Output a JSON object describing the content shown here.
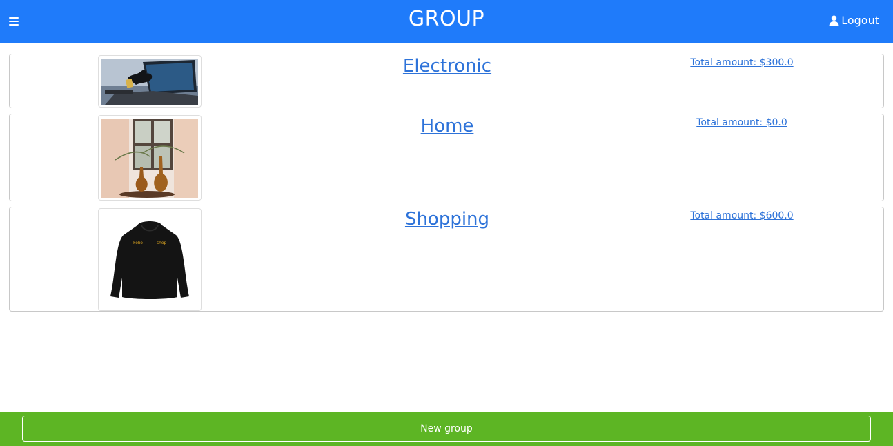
{
  "header": {
    "title": "GROUP",
    "logout_label": "Logout",
    "menu_icon": "hamburger-menu-icon",
    "user_icon": "user-icon"
  },
  "groups": [
    {
      "name": "Electronic",
      "total": "Total amount: $300.0",
      "image": "laptop-photo"
    },
    {
      "name": "Home",
      "total": "Total amount: $0.0",
      "image": "vases-photo"
    },
    {
      "name": "Shopping",
      "total": "Total amount: $600.0",
      "image": "hoodie-photo"
    }
  ],
  "footer": {
    "new_group_label": "New group"
  },
  "colors": {
    "header_bg": "#1f7bfa",
    "footer_bg": "#5db524",
    "link": "#2e73d9"
  }
}
